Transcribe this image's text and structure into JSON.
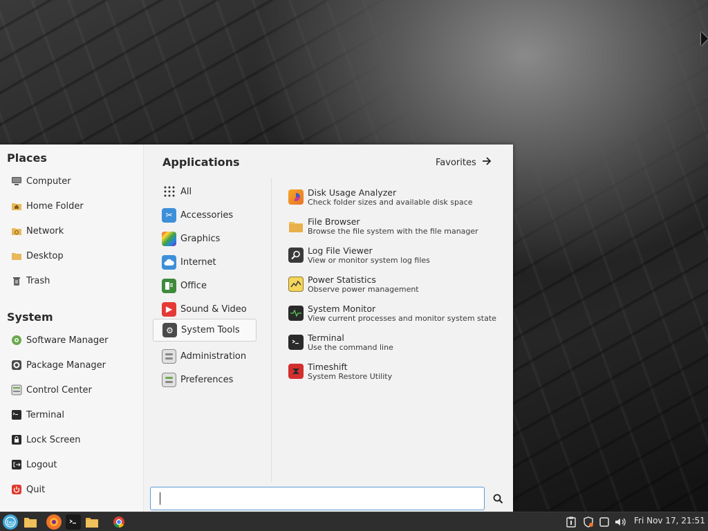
{
  "places": {
    "title": "Places",
    "items": [
      {
        "label": "Computer",
        "icon": "computer-icon"
      },
      {
        "label": "Home Folder",
        "icon": "home-folder-icon"
      },
      {
        "label": "Network",
        "icon": "network-folder-icon"
      },
      {
        "label": "Desktop",
        "icon": "desktop-folder-icon"
      },
      {
        "label": "Trash",
        "icon": "trash-icon"
      }
    ]
  },
  "system": {
    "title": "System",
    "items": [
      {
        "label": "Software Manager",
        "icon": "software-manager-icon"
      },
      {
        "label": "Package Manager",
        "icon": "package-manager-icon"
      },
      {
        "label": "Control Center",
        "icon": "control-center-icon"
      },
      {
        "label": "Terminal",
        "icon": "terminal-icon"
      },
      {
        "label": "Lock Screen",
        "icon": "lock-icon"
      },
      {
        "label": "Logout",
        "icon": "logout-icon"
      },
      {
        "label": "Quit",
        "icon": "power-icon"
      }
    ]
  },
  "applications": {
    "title": "Applications",
    "favorites_label": "Favorites",
    "categories": [
      {
        "label": "All",
        "icon": "grid-icon"
      },
      {
        "label": "Accessories",
        "icon": "accessories-icon"
      },
      {
        "label": "Graphics",
        "icon": "graphics-icon"
      },
      {
        "label": "Internet",
        "icon": "internet-cloud-icon"
      },
      {
        "label": "Office",
        "icon": "office-icon"
      },
      {
        "label": "Sound & Video",
        "icon": "play-icon"
      },
      {
        "label": "System Tools",
        "icon": "system-tools-gear-icon"
      },
      {
        "label": "Administration",
        "icon": "administration-icon"
      },
      {
        "label": "Preferences",
        "icon": "preferences-icon"
      }
    ],
    "active_category": "System Tools",
    "apps": [
      {
        "name": "Disk Usage Analyzer",
        "desc": "Check folder sizes and available disk space",
        "icon": "disk-usage-icon"
      },
      {
        "name": "File Browser",
        "desc": "Browse the file system with the file manager",
        "icon": "folder-icon"
      },
      {
        "name": "Log File Viewer",
        "desc": "View or monitor system log files",
        "icon": "magnifier-icon"
      },
      {
        "name": "Power Statistics",
        "desc": "Observe power management",
        "icon": "power-stats-icon"
      },
      {
        "name": "System Monitor",
        "desc": "View current processes and monitor system state",
        "icon": "system-monitor-icon"
      },
      {
        "name": "Terminal",
        "desc": "Use the command line",
        "icon": "terminal-icon"
      },
      {
        "name": "Timeshift",
        "desc": "System Restore Utility",
        "icon": "timeshift-icon"
      }
    ]
  },
  "search": {
    "value": "",
    "placeholder": ""
  },
  "taskbar": {
    "clock": "Fri Nov 17, 21:51",
    "launchers": [
      "mint-menu-icon",
      "folder-icon",
      "firefox-icon",
      "terminal-icon",
      "files-icon",
      "chrome-icon"
    ]
  },
  "colors": {
    "menu_bg": "#f2f2f2",
    "taskbar_bg": "#2e2e2e",
    "search_border": "#5b9bd5",
    "mint_green": "#86be43"
  }
}
